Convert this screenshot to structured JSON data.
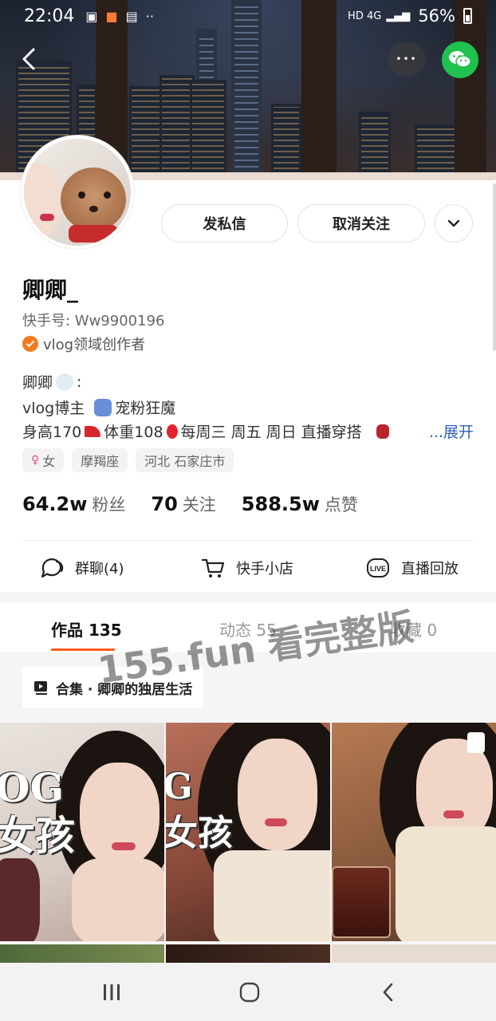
{
  "status_bar": {
    "time": "22:04",
    "network": "HD 4G",
    "battery": "56%"
  },
  "header": {
    "more_label": "•••",
    "icons": [
      "back-arrow-icon",
      "more-icon",
      "wechat-icon"
    ]
  },
  "profile": {
    "actions": {
      "message_label": "发私信",
      "unfollow_label": "取消关注"
    },
    "nickname": "卿卿_",
    "user_id": "快手号: Ww9900196",
    "creator_badge": "vlog领域创作者",
    "bio": {
      "line1": "卿卿",
      "line1_suffix": ":",
      "line2_a": "vlog博主",
      "line2_b": "宠粉狂魔",
      "line3_a": "身高170",
      "line3_b": "体重108",
      "line3_c": "每周三 周五 周日 直播穿搭",
      "expand_label": "...展开"
    },
    "tags": [
      {
        "label": "女",
        "icon": "gender-female-icon"
      },
      {
        "label": "摩羯座"
      },
      {
        "label": "河北 石家庄市"
      }
    ],
    "stats": [
      {
        "value": "64.2w",
        "label": "粉丝"
      },
      {
        "value": "70",
        "label": "关注"
      },
      {
        "value": "588.5w",
        "label": "点赞"
      }
    ]
  },
  "quick_actions": [
    {
      "label": "群聊(4)",
      "icon": "chat-bubble-icon"
    },
    {
      "label": "快手小店",
      "icon": "shopping-cart-icon"
    },
    {
      "label": "直播回放",
      "icon": "live-replay-icon"
    }
  ],
  "tabs": [
    {
      "label": "作品 135",
      "active": true
    },
    {
      "label": "动态 55",
      "active": false
    },
    {
      "label": "收藏 0",
      "active": false
    }
  ],
  "collection": {
    "label": "合集 · 卿卿的独居生活"
  },
  "watermark": "155.fun 看完整版",
  "video_thumbs": [
    {
      "overlay_text": "OG\n女孩"
    },
    {
      "overlay_text": "G\n女孩"
    },
    {
      "overlay_text": ""
    }
  ],
  "colors": {
    "accent": "#ff5a1f",
    "wechat": "#1fc14f",
    "link": "#2f5fb8"
  }
}
